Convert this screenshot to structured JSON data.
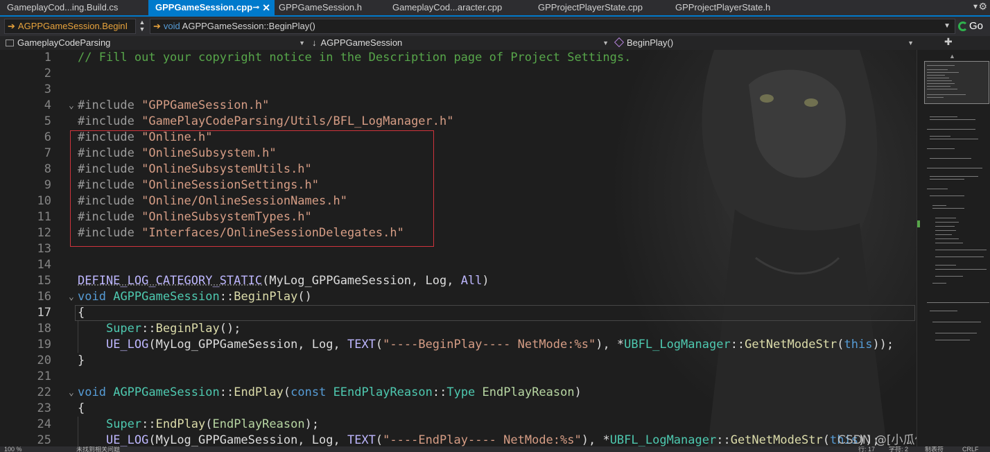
{
  "tabs": [
    {
      "label": "GameplayCod...ing.Build.cs",
      "active": false
    },
    {
      "label": "GPPGameSession.cpp",
      "active": true
    },
    {
      "label": "GPPGameSession.h",
      "active": false
    },
    {
      "label": "GameplayCod...aracter.cpp",
      "active": false
    },
    {
      "label": "GPProjectPlayerState.cpp",
      "active": false
    },
    {
      "label": "GPProjectPlayerState.h",
      "active": false
    }
  ],
  "toolbar": {
    "scope": "AGPPGameSession.BeginI",
    "function_keyword": "void",
    "function_name": "AGPPGameSession::BeginPlay()",
    "go_label": "Go"
  },
  "navbar": {
    "project": "GameplayCodeParsing",
    "class": "AGPPGameSession",
    "member": "BeginPlay()"
  },
  "editor": {
    "line_numbers": [
      "1",
      "2",
      "3",
      "4",
      "5",
      "6",
      "7",
      "8",
      "9",
      "10",
      "11",
      "12",
      "13",
      "14",
      "15",
      "16",
      "17",
      "18",
      "19",
      "20",
      "21",
      "22",
      "23",
      "24",
      "25"
    ],
    "current_line": "17"
  },
  "watermark": "CSDN @[小瓜偷学编程]",
  "status": {
    "zoom": "100 %",
    "issues": "未找到相关问题",
    "line_col": "行: 17",
    "chars": "字符: 2",
    "mode": "制表符",
    "eol": "CRLF"
  },
  "colors": {
    "accent": "#007acc",
    "highlight_box": "#d0343c",
    "comment": "#57a64a",
    "string": "#d69d85",
    "keyword": "#569cd6"
  }
}
